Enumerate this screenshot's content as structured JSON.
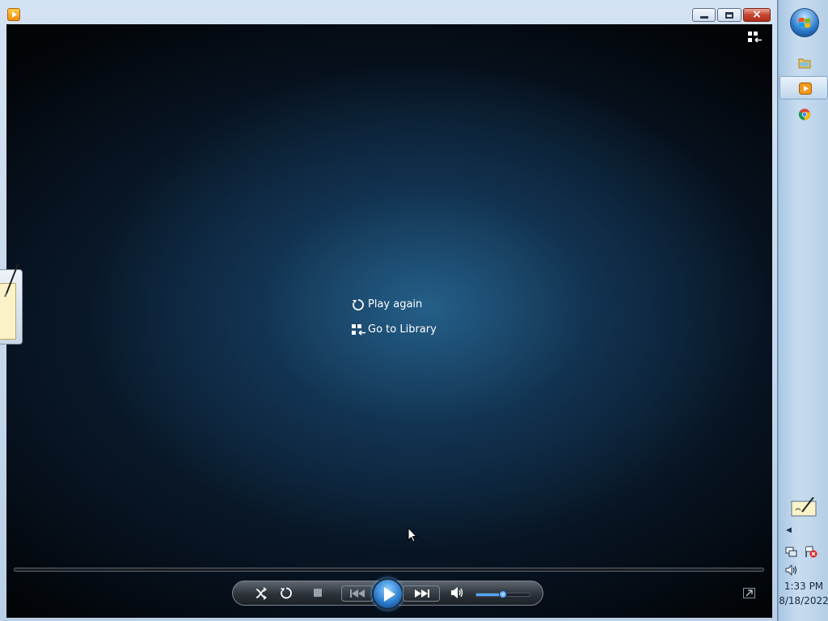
{
  "window": {
    "title": "",
    "controls": {
      "minimize": "",
      "maximize": "",
      "close": "×"
    }
  },
  "player": {
    "menu": [
      {
        "label": "Play again",
        "icon": "replay-icon"
      },
      {
        "label": "Go to Library",
        "icon": "library-icon"
      }
    ],
    "seek_progress": 0,
    "controls": {
      "shuffle_icon": "shuffle-icon",
      "repeat_icon": "repeat-icon",
      "stop_icon": "stop-icon",
      "previous_icon": "previous-icon",
      "play_icon": "play-icon",
      "next_icon": "next-icon",
      "mute_icon": "volume-icon",
      "volume_level": 0.5
    },
    "switch_to_library_icon": "switch-to-library-icon",
    "fullscreen_icon": "fullscreen-icon"
  },
  "taskbar": {
    "apps": [
      {
        "name": "windows-explorer-icon",
        "active": false
      },
      {
        "name": "windows-media-player-icon",
        "active": true
      },
      {
        "name": "chrome-icon",
        "active": false
      }
    ],
    "clock": {
      "time": "1:33 PM",
      "date": "8/18/2022"
    }
  },
  "colors": {
    "accent": "#2f7fd0",
    "video_glow": "#26628c",
    "taskbar": "#c8dcef"
  }
}
